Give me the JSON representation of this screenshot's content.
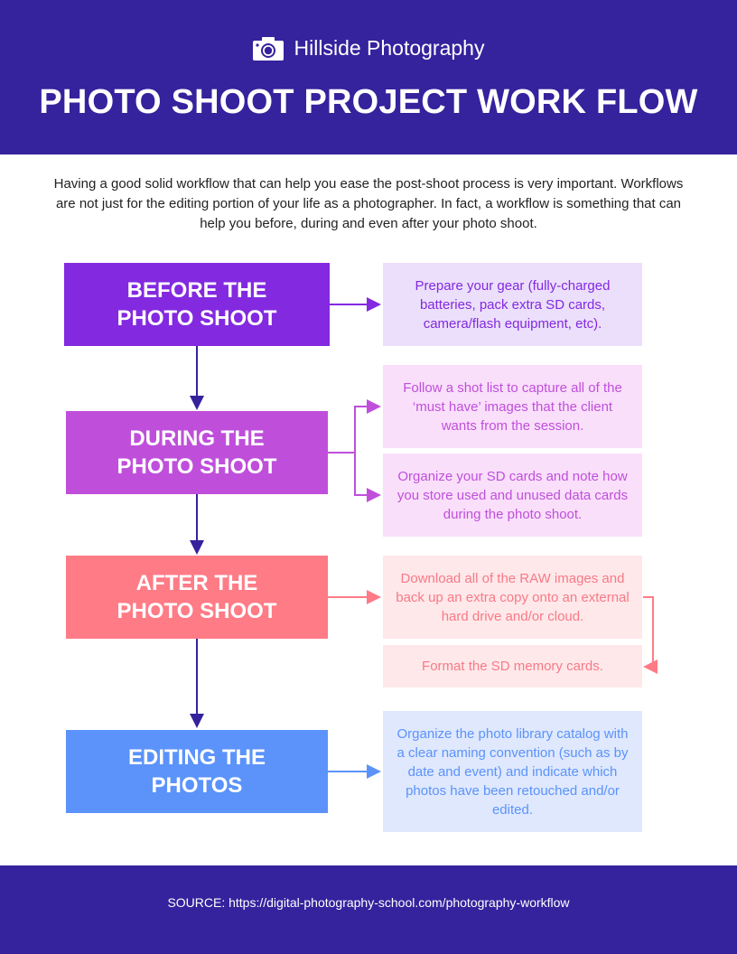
{
  "header": {
    "brand_icon": "camera-icon",
    "brand_name": "Hillside Photography",
    "title": "PHOTO SHOOT PROJECT WORK FLOW"
  },
  "intro": "Having a good solid workflow that can help you ease the post-shoot process is very important. Workflows are not just for the editing portion of your life as a photographer. In fact, a workflow is something that can help you before, during and even after your photo shoot.",
  "colors": {
    "header_bg": "#35229d",
    "connector": "#35229d",
    "before": "#8329e0",
    "during": "#bf4fdb",
    "after": "#ff7b86",
    "editing": "#5b93fb"
  },
  "steps": [
    {
      "label_line1": "BEFORE THE",
      "label_line2": "PHOTO SHOOT",
      "notes": [
        "Prepare your gear (fully-charged batteries, pack extra SD cards, camera/flash equipment, etc)."
      ]
    },
    {
      "label_line1": "DURING THE",
      "label_line2": "PHOTO SHOOT",
      "notes": [
        "Follow a shot list to capture all of the ‘must have’ images that the client wants from the session.",
        "Organize your SD cards and note how you store used and unused data cards during the photo shoot."
      ]
    },
    {
      "label_line1": "AFTER THE",
      "label_line2": "PHOTO SHOOT",
      "notes": [
        "Download all of the RAW images and back up an extra copy onto an external hard drive and/or cloud.",
        "Format the SD memory cards."
      ]
    },
    {
      "label_line1": "EDITING THE",
      "label_line2": "PHOTOS",
      "notes": [
        "Organize the photo library catalog with a clear naming convention (such as by date and event) and indicate which photos have been retouched and/or edited."
      ]
    }
  ],
  "footer": {
    "source": "SOURCE: https://digital-photography-school.com/photography-workflow"
  }
}
